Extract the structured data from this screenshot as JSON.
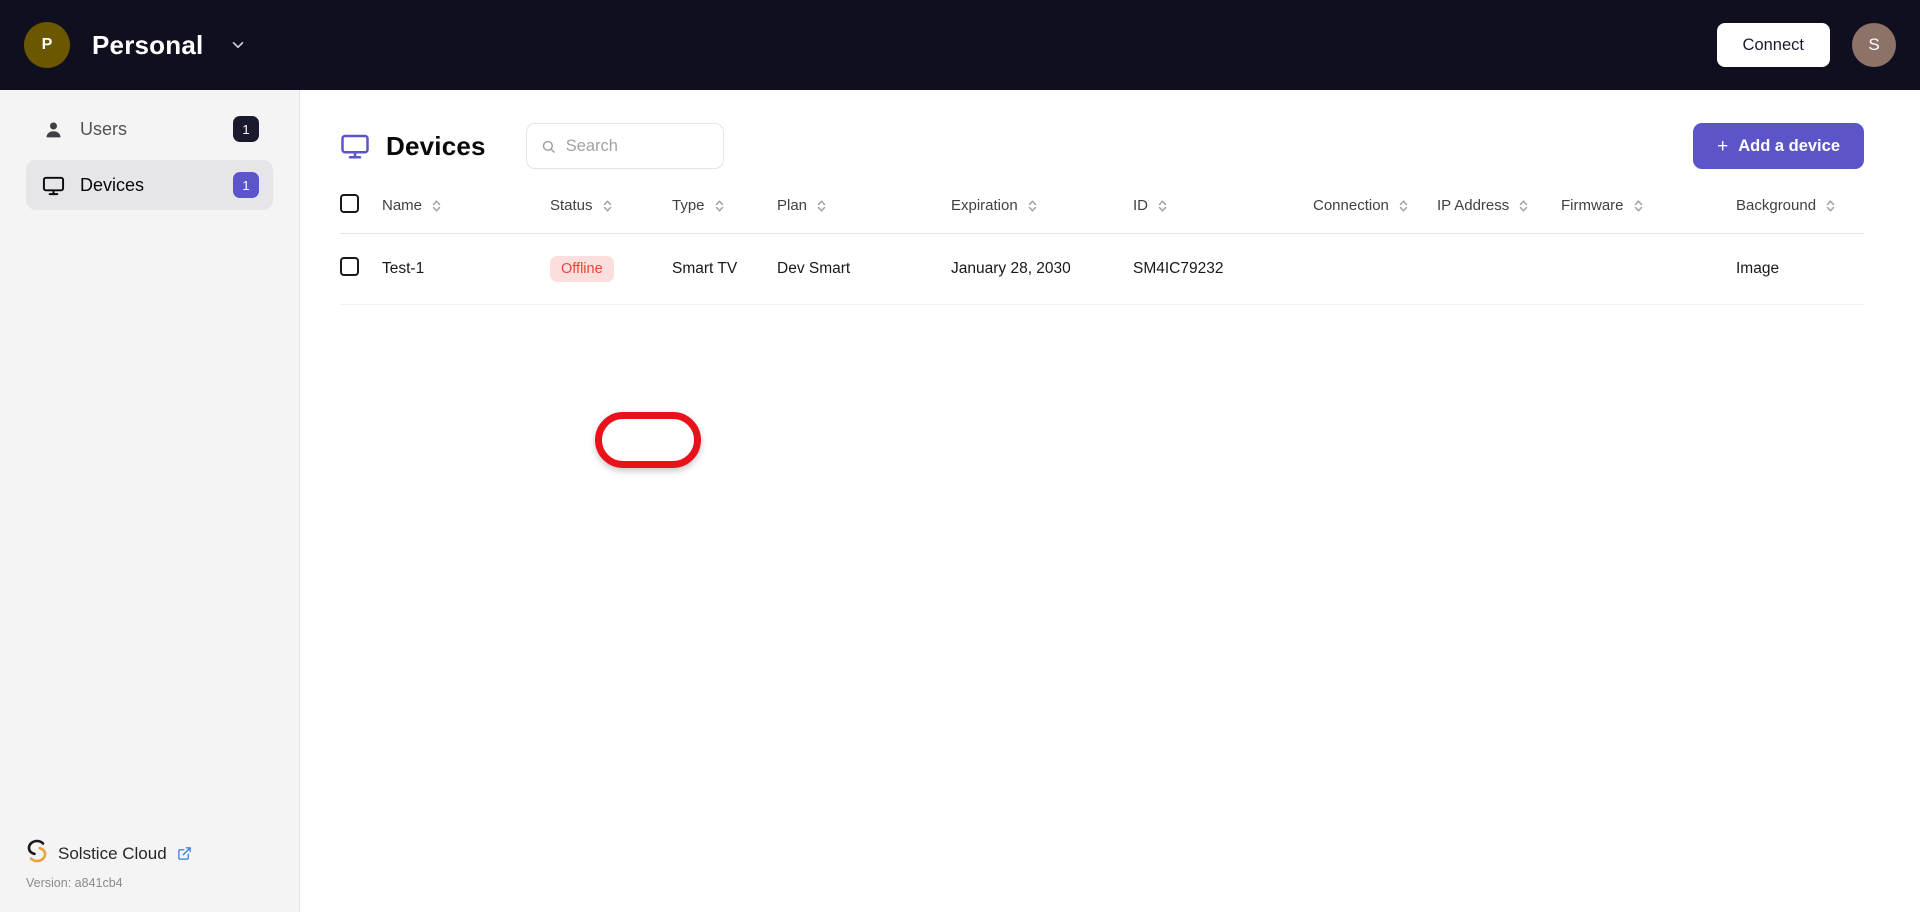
{
  "topbar": {
    "org_avatar_letter": "P",
    "org_avatar_color": "#6b5700",
    "org_name": "Personal",
    "caret_icon": "chevron-down-icon",
    "connect_label": "Connect",
    "user_avatar_letter": "S",
    "user_avatar_color": "#8d7268"
  },
  "sidebar": {
    "items": [
      {
        "icon": "user-icon",
        "label": "Users",
        "badge": "1",
        "active": false
      },
      {
        "icon": "monitor-icon",
        "label": "Devices",
        "badge": "1",
        "active": true
      }
    ],
    "footer": {
      "brand_icon": "solstice-logo-icon",
      "brand_name": "Solstice Cloud",
      "external_link_icon": "external-link-icon",
      "version": "Version: a841cb4"
    }
  },
  "main": {
    "page_icon": "monitor-icon",
    "page_title": "Devices",
    "search": {
      "placeholder": "Search",
      "value": "",
      "icon": "search-icon"
    },
    "add_button": {
      "plus": "+",
      "label": "Add a device"
    },
    "accent_color": "#5b55c9"
  },
  "table": {
    "sort_icon": "sort-chevrons-icon",
    "columns": [
      {
        "key": "name",
        "label": "Name"
      },
      {
        "key": "status",
        "label": "Status"
      },
      {
        "key": "type",
        "label": "Type"
      },
      {
        "key": "plan",
        "label": "Plan"
      },
      {
        "key": "expiration",
        "label": "Expiration"
      },
      {
        "key": "id",
        "label": "ID"
      },
      {
        "key": "connection",
        "label": "Connection"
      },
      {
        "key": "ip_address",
        "label": "IP Address"
      },
      {
        "key": "firmware",
        "label": "Firmware"
      },
      {
        "key": "background",
        "label": "Background"
      }
    ],
    "rows": [
      {
        "selected": false,
        "name": "Test-1",
        "status": "Offline",
        "status_color": "#f04438",
        "status_bg": "#fbdedd",
        "type": "Smart TV",
        "plan": "Dev Smart",
        "expiration": "January 28, 2030",
        "id": "SM4IC79232",
        "connection": "",
        "ip_address": "",
        "firmware": "",
        "background": "Image"
      }
    ]
  },
  "annotation": {
    "shape": "oval-highlight",
    "color": "#e8121b",
    "targets": "Test-1"
  }
}
